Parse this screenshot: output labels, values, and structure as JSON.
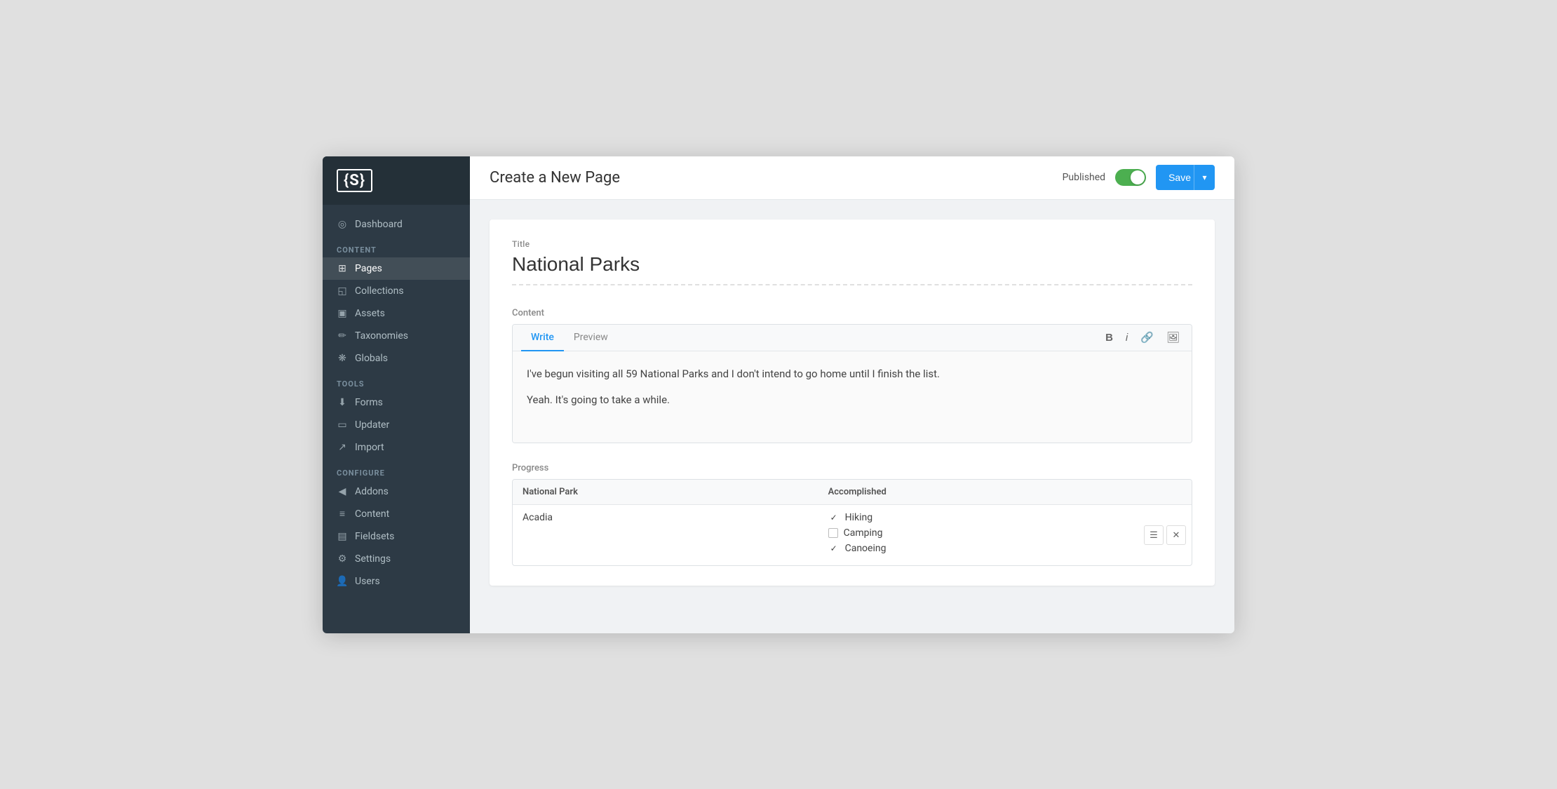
{
  "sidebar": {
    "logo": "{S}",
    "nav": {
      "dashboard": {
        "label": "Dashboard",
        "icon": "◎"
      },
      "content_section_label": "CONTENT",
      "items_content": [
        {
          "label": "Pages",
          "icon": "⊞",
          "active": true
        },
        {
          "label": "Collections",
          "icon": "◱"
        },
        {
          "label": "Assets",
          "icon": "▣"
        },
        {
          "label": "Taxonomies",
          "icon": "✏"
        },
        {
          "label": "Globals",
          "icon": "❋"
        }
      ],
      "tools_section_label": "TOOLS",
      "items_tools": [
        {
          "label": "Forms",
          "icon": "⬇"
        },
        {
          "label": "Updater",
          "icon": "▭"
        },
        {
          "label": "Import",
          "icon": "↗"
        }
      ],
      "configure_section_label": "CONFIGURE",
      "items_configure": [
        {
          "label": "Addons",
          "icon": "◀"
        },
        {
          "label": "Content",
          "icon": "≡"
        },
        {
          "label": "Fieldsets",
          "icon": "▤"
        },
        {
          "label": "Settings",
          "icon": "⚙"
        },
        {
          "label": "Users",
          "icon": "👤"
        }
      ]
    }
  },
  "topbar": {
    "title": "Create a New Page",
    "published_label": "Published",
    "save_label": "Save",
    "toggle_on": true
  },
  "form": {
    "title_label": "Title",
    "title_value": "National Parks",
    "content_label": "Content",
    "editor_tabs": [
      "Write",
      "Preview"
    ],
    "active_tab": "Write",
    "editor_toolbar": [
      "B",
      "i",
      "🔗",
      "🖼"
    ],
    "body_lines": [
      "I've begun visiting all 59 National Parks and I don't intend to go home until I finish the list.",
      "Yeah. It's going to take a while."
    ],
    "progress_label": "Progress",
    "progress_columns": [
      "National Park",
      "Accomplished"
    ],
    "progress_rows": [
      {
        "park": "Acadia",
        "accomplished": [
          {
            "label": "Hiking",
            "checked": true
          },
          {
            "label": "Camping",
            "checked": false
          },
          {
            "label": "Canoeing",
            "checked": true
          }
        ]
      }
    ]
  },
  "colors": {
    "accent": "#2196F3",
    "toggle_on": "#4caf50",
    "sidebar_bg": "#2d3a45",
    "sidebar_active_bg": "#243038"
  }
}
